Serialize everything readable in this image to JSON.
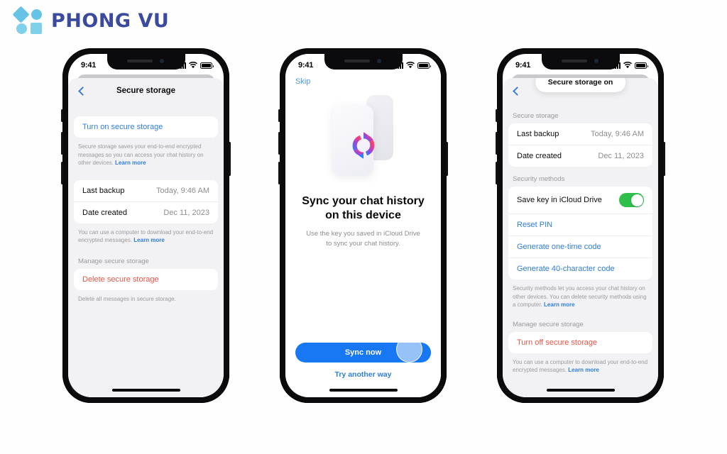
{
  "brand": {
    "name": "PHONG VU",
    "accent_shape_color": "#6ec7e8",
    "text_color": "#3a4a9e"
  },
  "status_bar": {
    "time": "9:41",
    "signal_icon": "cellular-bars-icon",
    "wifi_icon": "wifi-icon",
    "battery_icon": "battery-icon"
  },
  "colors": {
    "link_blue": "#2f7ed8",
    "destructive_red": "#e8554a",
    "toggle_green": "#2ec04b",
    "cta_blue": "#1877f2"
  },
  "phones": [
    {
      "id": "secure-storage-off",
      "nav": {
        "back_icon": "back-chevron-icon",
        "title": "Secure storage"
      },
      "sections": [
        {
          "header": "",
          "rows": [
            {
              "kind": "action",
              "label": "Turn on secure storage"
            }
          ],
          "footnote": "Secure storage saves your end-to-end encrypted messages so you can access your chat history on other devices.",
          "footnote_link": "Learn more"
        },
        {
          "header": "",
          "rows": [
            {
              "kind": "value",
              "label": "Last backup",
              "value": "Today, 9:46 AM"
            },
            {
              "kind": "value",
              "label": "Date created",
              "value": "Dec 11, 2023"
            }
          ],
          "footnote": "You can use a computer to download your end-to-end encrypted messages.",
          "footnote_link": "Learn more"
        },
        {
          "header": "Manage secure storage",
          "rows": [
            {
              "kind": "destructive",
              "label": "Delete secure storage"
            }
          ],
          "footnote": "Delete all messages in secure storage.",
          "footnote_link": ""
        }
      ]
    },
    {
      "id": "sync-onboarding",
      "skip_label": "Skip",
      "illustration": "sync-devices-illustration",
      "title": "Sync your chat history on this device",
      "subtitle": "Use the key you saved in iCloud Drive to sync your chat history.",
      "primary_button": "Sync now",
      "secondary_button": "Try another way",
      "cursor": "tap-indicator"
    },
    {
      "id": "secure-storage-on",
      "nav": {
        "back_icon": "back-chevron-icon",
        "title": ""
      },
      "toast": "Secure storage on",
      "sections": [
        {
          "header": "Secure storage",
          "rows": [
            {
              "kind": "value",
              "label": "Last backup",
              "value": "Today, 9:46 AM"
            },
            {
              "kind": "value",
              "label": "Date created",
              "value": "Dec 11, 2023"
            }
          ],
          "footnote": "",
          "footnote_link": ""
        },
        {
          "header": "Security methods",
          "rows": [
            {
              "kind": "toggle",
              "label": "Save key in iCloud Drive",
              "toggle_on": true
            },
            {
              "kind": "action",
              "label": "Reset PIN"
            },
            {
              "kind": "action",
              "label": "Generate one-time code"
            },
            {
              "kind": "action",
              "label": "Generate 40-character code"
            }
          ],
          "footnote": "Security methods let you access your chat history on other devices. You can delete security methods using a computer.",
          "footnote_link": "Learn more"
        },
        {
          "header": "Manage secure storage",
          "rows": [
            {
              "kind": "destructive",
              "label": "Turn off secure storage"
            }
          ],
          "footnote": "You can use a computer to download your end-to-end encrypted messages.",
          "footnote_link": "Learn more"
        }
      ]
    }
  ]
}
